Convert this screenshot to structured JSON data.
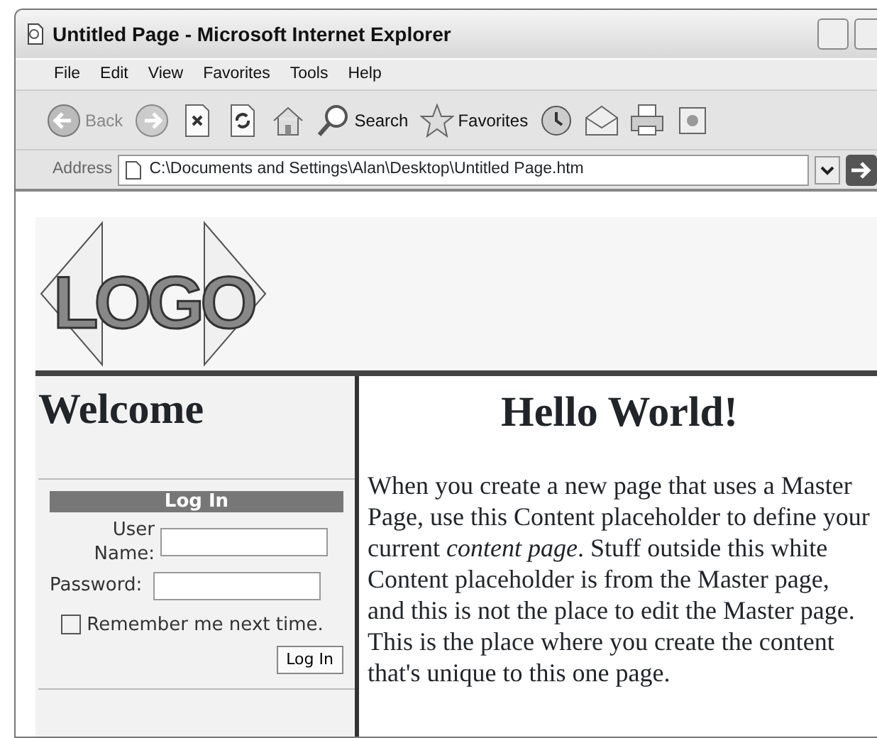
{
  "window": {
    "title": "Untitled Page - Microsoft Internet Explorer"
  },
  "menu": [
    "File",
    "Edit",
    "View",
    "Favorites",
    "Tools",
    "Help"
  ],
  "toolbar": [
    {
      "kind": "back",
      "label": "Back"
    },
    {
      "kind": "forward"
    },
    {
      "kind": "stop"
    },
    {
      "kind": "refresh"
    },
    {
      "kind": "home"
    },
    {
      "kind": "search",
      "label": "Search"
    },
    {
      "kind": "favorites",
      "label": "Favorites"
    },
    {
      "kind": "history"
    },
    {
      "kind": "mail"
    },
    {
      "kind": "print"
    },
    {
      "kind": "edit"
    }
  ],
  "address": {
    "label": "Address",
    "value": "C:\\Documents and Settings\\Alan\\Desktop\\Untitled Page.htm"
  },
  "page": {
    "logo": "LOGO",
    "sidebar_title": "Welcome",
    "login": {
      "title": "Log In",
      "user_label": "User Name:",
      "password_label": "Password:",
      "remember": {
        "label": "Remember me next time.",
        "checked": false
      },
      "button": "Log In"
    },
    "heading": "Hello World!",
    "body": "When you create a new page that uses a Master Page, use this Content placeholder to define your current *content page*. Stuff outside this white Content placeholder is from the Master page, and this is not the place to edit the Master page. This is the place where you create the content that's unique to this one page."
  }
}
